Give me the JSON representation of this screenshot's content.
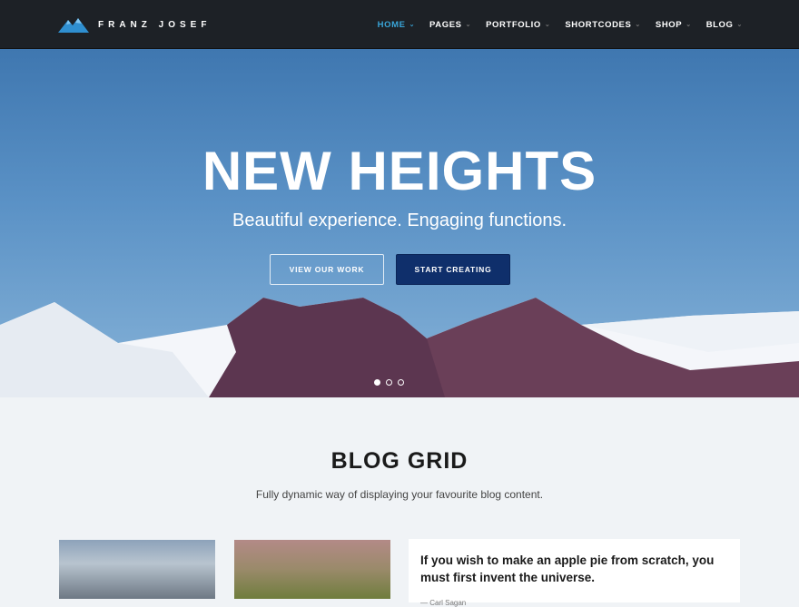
{
  "header": {
    "logo_text": "FRANZ JOSEF",
    "nav": [
      {
        "label": "HOME",
        "active": true
      },
      {
        "label": "PAGES"
      },
      {
        "label": "PORTFOLIO"
      },
      {
        "label": "SHORTCODES"
      },
      {
        "label": "SHOP"
      },
      {
        "label": "BLOG"
      }
    ]
  },
  "hero": {
    "title": "NEW HEIGHTS",
    "subtitle": "Beautiful experience. Engaging functions.",
    "btn_view": "VIEW OUR WORK",
    "btn_start": "START CREATING",
    "slides": 3,
    "active_slide": 1
  },
  "blog": {
    "title": "BLOG GRID",
    "subtitle": "Fully dynamic way of displaying your favourite blog content.",
    "quote": "If you wish to make an apple pie from scratch, you must first invent the universe.",
    "quote_author": "— Carl Sagan"
  },
  "colors": {
    "topbar": "#1d2126",
    "accent": "#39a6d9",
    "button_solid": "#0f2f6b"
  }
}
